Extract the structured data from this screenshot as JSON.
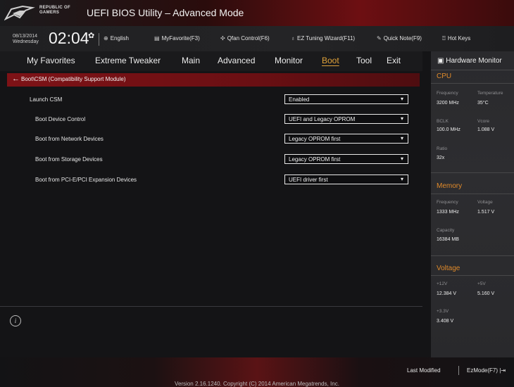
{
  "header": {
    "brand_line1": "REPUBLIC OF",
    "brand_line2": "GAMERS",
    "title": "UEFI BIOS Utility – Advanced Mode"
  },
  "toolbar": {
    "date": "08/13/2014",
    "day": "Wednesday",
    "time": "02:04",
    "language": "English",
    "myfavorite": "MyFavorite(F3)",
    "qfan": "Qfan Control(F6)",
    "ez_tuning": "EZ Tuning Wizard(F11)",
    "quick_note": "Quick Note(F9)",
    "hot_keys": "Hot Keys"
  },
  "menu": {
    "items": [
      "My Favorites",
      "Extreme Tweaker",
      "Main",
      "Advanced",
      "Monitor",
      "Boot",
      "Tool",
      "Exit"
    ],
    "active": "Boot"
  },
  "path": "Boot\\CSM (Compatibility Support Module)",
  "settings": [
    {
      "label": "Launch CSM",
      "value": "Enabled"
    },
    {
      "label": "Boot Device Control",
      "value": "UEFI and Legacy OPROM"
    },
    {
      "label": "Boot from Network Devices",
      "value": "Legacy OPROM first"
    },
    {
      "label": "Boot from Storage Devices",
      "value": "Legacy OPROM first"
    },
    {
      "label": "Boot from PCI-E/PCI Expansion Devices",
      "value": "UEFI driver first"
    }
  ],
  "hardware_monitor": {
    "title": "Hardware Monitor",
    "cpu": {
      "title": "CPU",
      "frequency_label": "Frequency",
      "frequency": "3200 MHz",
      "temperature_label": "Temperature",
      "temperature": "35°C",
      "bclk_label": "BCLK",
      "bclk": "100.0 MHz",
      "vcore_label": "Vcore",
      "vcore": "1.088 V",
      "ratio_label": "Ratio",
      "ratio": "32x"
    },
    "memory": {
      "title": "Memory",
      "frequency_label": "Frequency",
      "frequency": "1333 MHz",
      "voltage_label": "Voltage",
      "voltage": "1.517 V",
      "capacity_label": "Capacity",
      "capacity": "16384 MB"
    },
    "voltage": {
      "title": "Voltage",
      "v12_label": "+12V",
      "v12": "12.384 V",
      "v5_label": "+5V",
      "v5": "5.160 V",
      "v33_label": "+3.3V",
      "v33": "3.408 V"
    }
  },
  "footer": {
    "last_modified": "Last Modified",
    "ezmode": "EzMode(F7)",
    "copyright": "Version 2.16.1240. Copyright (C) 2014 American Megatrends, Inc."
  },
  "colors": {
    "accent_orange": "#e0a23a",
    "path_red": "#7e1216"
  }
}
